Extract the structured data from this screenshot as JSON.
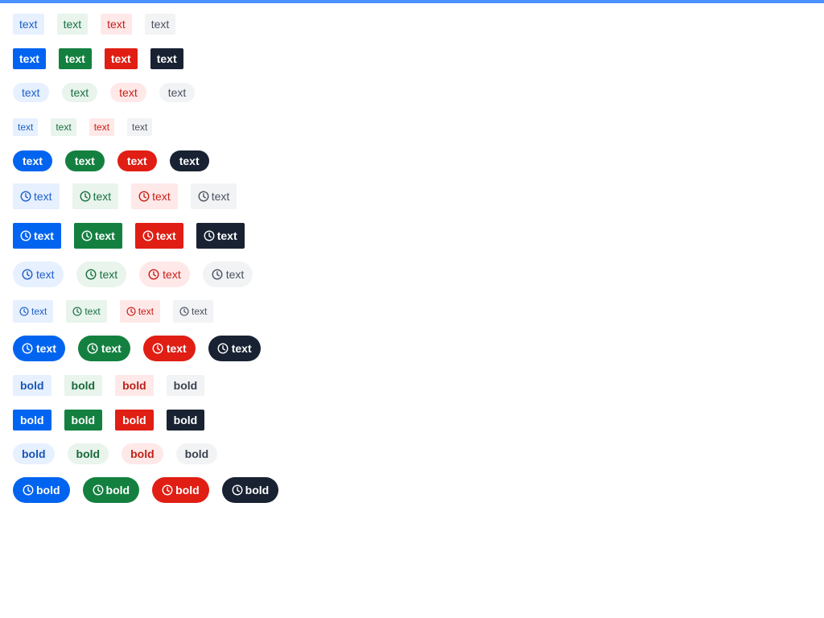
{
  "colors": {
    "top_bar": "#4a90ff",
    "blue": "#0064f0",
    "green": "#148040",
    "red": "#e01e14",
    "dark": "#182232",
    "blue_light_bg": "#e6f0ff",
    "green_light_bg": "#e8f4ec",
    "red_light_bg": "#ffe8e8",
    "gray_light_bg": "#f2f3f5",
    "blue_light_fg": "#2060c8",
    "green_light_fg": "#1a7040",
    "red_light_fg": "#c82018",
    "gray_light_fg": "#4a5260"
  },
  "icon": "clock-icon",
  "rows": [
    {
      "id": "light-square",
      "labels": [
        "text",
        "text",
        "text",
        "text"
      ]
    },
    {
      "id": "solid-square",
      "labels": [
        "text",
        "text",
        "text",
        "text"
      ]
    },
    {
      "id": "light-pill",
      "labels": [
        "text",
        "text",
        "text",
        "text"
      ]
    },
    {
      "id": "light-small",
      "labels": [
        "text",
        "text",
        "text",
        "text"
      ]
    },
    {
      "id": "solid-pill",
      "labels": [
        "text",
        "text",
        "text",
        "text"
      ]
    },
    {
      "id": "light-icon-square",
      "labels": [
        "text",
        "text",
        "text",
        "text"
      ]
    },
    {
      "id": "solid-icon-square",
      "labels": [
        "text",
        "text",
        "text",
        "text"
      ]
    },
    {
      "id": "light-icon-pill",
      "labels": [
        "text",
        "text",
        "text",
        "text"
      ]
    },
    {
      "id": "light-icon-small",
      "labels": [
        "text",
        "text",
        "text",
        "text"
      ]
    },
    {
      "id": "solid-icon-pill",
      "labels": [
        "text",
        "text",
        "text",
        "text"
      ]
    },
    {
      "id": "bold-light-square",
      "labels": [
        "bold",
        "bold",
        "bold",
        "bold"
      ]
    },
    {
      "id": "bold-solid-square",
      "labels": [
        "bold",
        "bold",
        "bold",
        "bold"
      ]
    },
    {
      "id": "bold-light-pill",
      "labels": [
        "bold",
        "bold",
        "bold",
        "bold"
      ]
    },
    {
      "id": "bold-solid-icon-pill",
      "labels": [
        "bold",
        "bold",
        "bold",
        "bold"
      ]
    }
  ]
}
